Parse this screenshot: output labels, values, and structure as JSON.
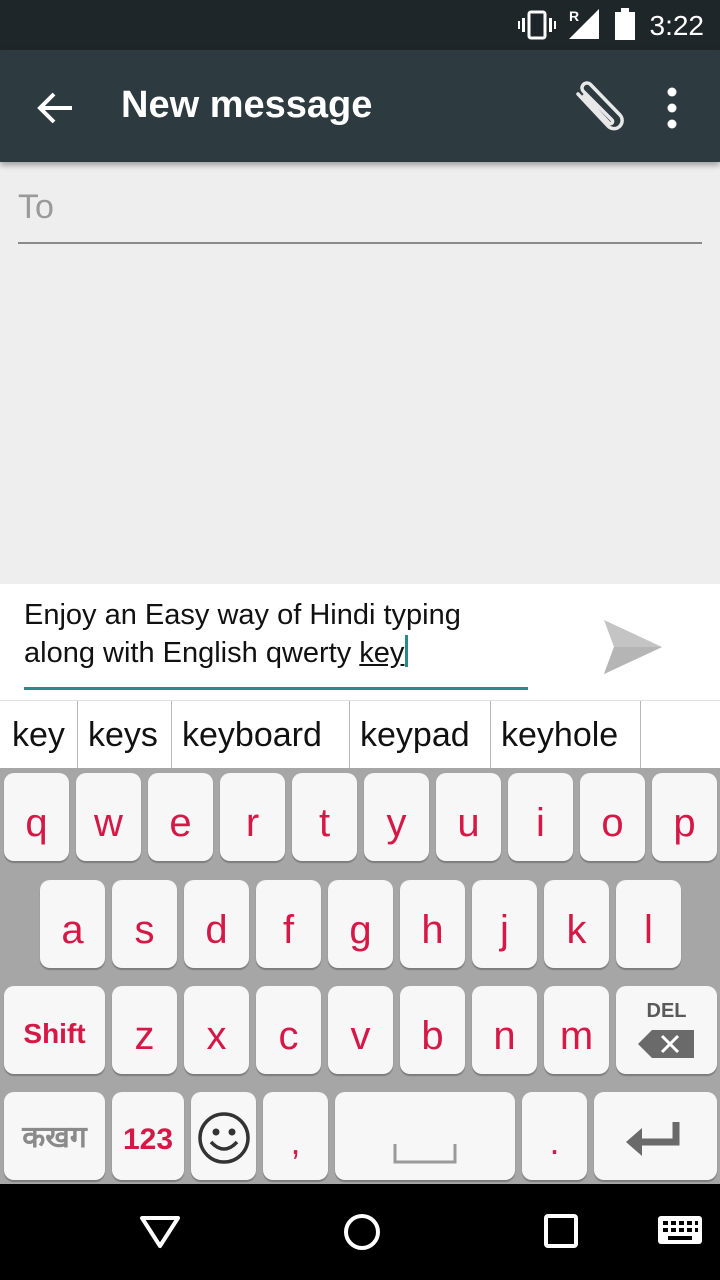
{
  "status_bar": {
    "time": "3:22",
    "icons": [
      "vibrate-icon",
      "signal-roaming-icon",
      "battery-icon"
    ],
    "roaming_label": "R"
  },
  "app_bar": {
    "title": "New message",
    "icons": [
      "back-arrow-icon",
      "paperclip-icon",
      "overflow-menu-icon"
    ]
  },
  "to_field": {
    "label": "To"
  },
  "compose": {
    "line1": "Enjoy an Easy way of Hindi typing",
    "line2_prefix": "along with English qwerty ",
    "current_word": "key"
  },
  "suggestions": [
    "key",
    "keys",
    "keyboard",
    "keypad",
    "keyhole"
  ],
  "keyboard": {
    "row1": [
      "q",
      "w",
      "e",
      "r",
      "t",
      "y",
      "u",
      "i",
      "o",
      "p"
    ],
    "row2": [
      "a",
      "s",
      "d",
      "f",
      "g",
      "h",
      "j",
      "k",
      "l"
    ],
    "row3": [
      "z",
      "x",
      "c",
      "v",
      "b",
      "n",
      "m"
    ],
    "shift_label": "Shift",
    "delete_label": "DEL",
    "hindi_label": "कखग",
    "numbers_label": "123",
    "comma_label": ",",
    "period_label": ".",
    "icons": [
      "emoji-icon",
      "space-bar-icon",
      "enter-icon",
      "backspace-icon"
    ],
    "key_color": "#d51846"
  },
  "nav_bar": {
    "icons": [
      "back-triangle-icon",
      "home-circle-icon",
      "recents-square-icon",
      "keyboard-switch-icon"
    ]
  }
}
